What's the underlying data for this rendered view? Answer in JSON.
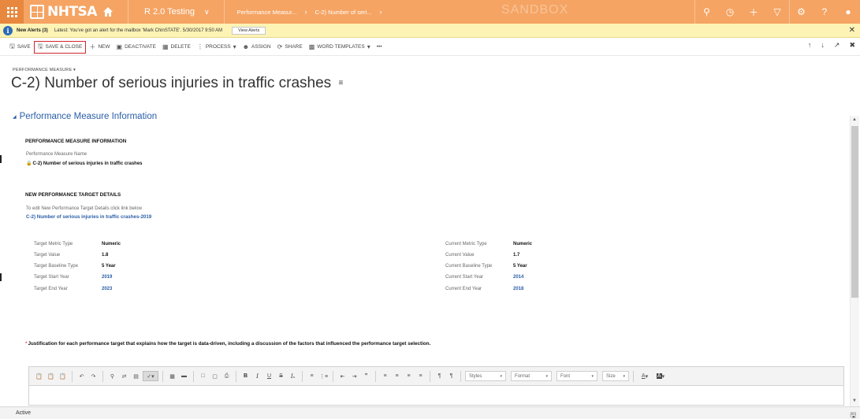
{
  "nav": {
    "brand": "NHTSA",
    "app_name": "R 2.0 Testing",
    "crumb_entity": "Performance Measur...",
    "crumb_record": "C-2) Number of seri...",
    "watermark": "SANDBOX",
    "icons": [
      "search-icon",
      "history-icon",
      "plus-icon",
      "filter-icon",
      "gear-icon",
      "help-icon",
      "user-icon"
    ]
  },
  "alert": {
    "title": "New Alerts (3)",
    "message": "Latest: You've got an alert for the mailbox 'Mark ChinSTATE'. 5/30/2017 9:50 AM",
    "button": "View Alerts"
  },
  "commands": {
    "save": "SAVE",
    "save_close": "SAVE & CLOSE",
    "new": "NEW",
    "deactivate": "DEACTIVATE",
    "delete": "DELETE",
    "process": "PROCESS",
    "assign": "ASSIGN",
    "share": "SHARE",
    "word_templates": "WORD TEMPLATES",
    "more": "•••"
  },
  "header": {
    "entity_type": "PERFORMANCE MEASURE",
    "title": "C-2) Number of serious injuries in traffic crashes"
  },
  "section": {
    "title": "Performance Measure Information",
    "info_heading": "PERFORMANCE MEASURE INFORMATION",
    "name_label": "Performance Measure Name",
    "name_value": "C-2) Number of serious injuries in traffic crashes",
    "target_heading": "NEW PERFORMANCE TARGET DETAILS",
    "edit_hint": "To edit New Performance Target Details click link below",
    "target_link": "C-2) Number of serious injuries in traffic crashes-2019"
  },
  "target_fields": [
    {
      "label": "Target Metric Type",
      "value": "Numeric",
      "blue": false
    },
    {
      "label": "Target Value",
      "value": "1.8",
      "blue": false
    },
    {
      "label": "Target Baseline Type",
      "value": "5 Year",
      "blue": false
    },
    {
      "label": "Target Start Year",
      "value": "2019",
      "blue": true
    },
    {
      "label": "Target End Year",
      "value": "2023",
      "blue": true
    }
  ],
  "current_fields": [
    {
      "label": "Current Metric Type",
      "value": "Numeric",
      "blue": false
    },
    {
      "label": "Current Value",
      "value": "1.7",
      "blue": false
    },
    {
      "label": "Current Baseline Type",
      "value": "5 Year",
      "blue": false
    },
    {
      "label": "Current Start Year",
      "value": "2014",
      "blue": true
    },
    {
      "label": "Current End Year",
      "value": "2018",
      "blue": true
    }
  ],
  "justification": {
    "required_marker": "*",
    "label": "Justification for each performance target that explains how the target is data-driven, including a discussion of the factors that influenced the performance target selection."
  },
  "editor": {
    "styles": "Styles",
    "format": "Format",
    "font": "Font",
    "size": "Size"
  },
  "status": {
    "text": "Active"
  }
}
